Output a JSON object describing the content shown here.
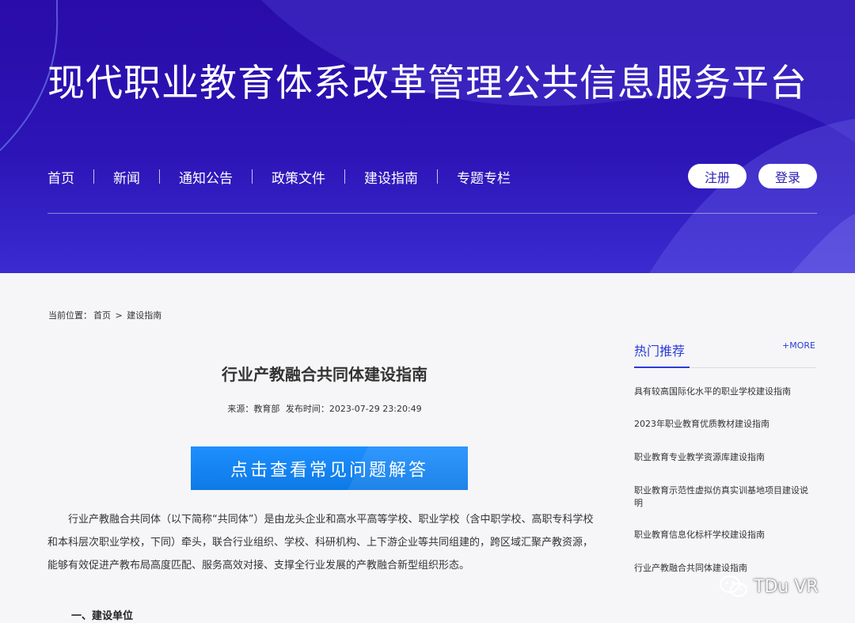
{
  "header": {
    "title": "现代职业教育体系改革管理公共信息服务平台",
    "nav": [
      "首页",
      "新闻",
      "通知公告",
      "政策文件",
      "建设指南",
      "专题专栏"
    ],
    "register_label": "注册",
    "login_label": "登录"
  },
  "breadcrumb": {
    "prefix": "当前位置：",
    "home": "首页",
    "separator": ">",
    "current": "建设指南"
  },
  "article": {
    "title": "行业产教融合共同体建设指南",
    "source": "来源：教育部",
    "publish_time": "发布时间：2023-07-29 23:20:49",
    "banner_label": "点击查看常见问题解答",
    "paragraph": "行业产教融合共同体（以下简称“共同体”）是由龙头企业和高水平高等学校、职业学校（含中职学校、高职专科学校和本科层次职业学校，下同）牵头，联合行业组织、学校、科研机构、上下游企业等共同组建的，跨区域汇聚产教资源，能够有效促进产教布局高度匹配、服务高效对接、支撑全行业发展的产教融合新型组织形态。",
    "section_heading": "一、建设单位"
  },
  "sidebar": {
    "title": "热门推荐",
    "more": "+MORE",
    "items": [
      "具有较高国际化水平的职业学校建设指南",
      "2023年职业教育优质教材建设指南",
      "职业教育专业教学资源库建设指南",
      "职业教育示范性虚拟仿真实训基地项目建设说明",
      "职业教育信息化标杆学校建设指南",
      "行业产教融合共同体建设指南"
    ]
  },
  "watermark": "TDu VR",
  "colors": {
    "header_bg": "#2c14b6",
    "accent": "#2b3dd6",
    "banner": "#1e8fff",
    "page_bg": "#f6f6f8"
  }
}
